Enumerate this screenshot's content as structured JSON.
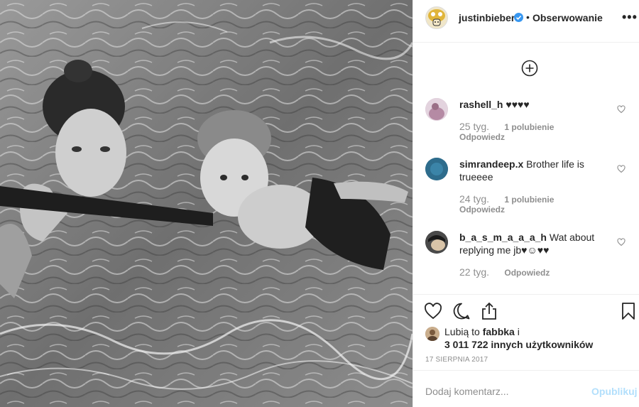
{
  "header": {
    "username": "justinbieber",
    "separator": "•",
    "follow_status": "Obserwowanie",
    "more_label": "•••"
  },
  "comments": [
    {
      "username": "rashell_h",
      "text": "♥♥♥♥",
      "text_line2": "",
      "time": "25 tyg.",
      "likes": "1 polubienie",
      "reply": "Odpowiedz"
    },
    {
      "username": "simrandeep.x",
      "text": "Brother life is",
      "text_line2": "trueeee",
      "time": "24 tyg.",
      "likes": "1 polubienie",
      "reply": "Odpowiedz"
    },
    {
      "username": "b_a_s_m_a_a_a_h",
      "text": "Wat about",
      "text_line2": "replying me jb♥☺♥♥",
      "time": "22 tyg.",
      "likes": "",
      "reply": "Odpowiedz"
    }
  ],
  "likes_line": {
    "prefix": "Lubią to",
    "user": "fabbka",
    "joiner": "i",
    "count_text": "3 011 722 innych użytkowników"
  },
  "date": "17 SIERPNIA 2017",
  "add_comment": {
    "placeholder": "Dodaj komentarz...",
    "publish": "Opublikuj"
  },
  "icons": {
    "like": "heart-icon",
    "comment": "comment-icon",
    "share": "share-icon",
    "save": "bookmark-icon",
    "load_more": "plus-circle-icon"
  },
  "colors": {
    "verified": "#3897f0",
    "publish_disabled": "#b2dffc",
    "meta": "#8e8e8e"
  }
}
